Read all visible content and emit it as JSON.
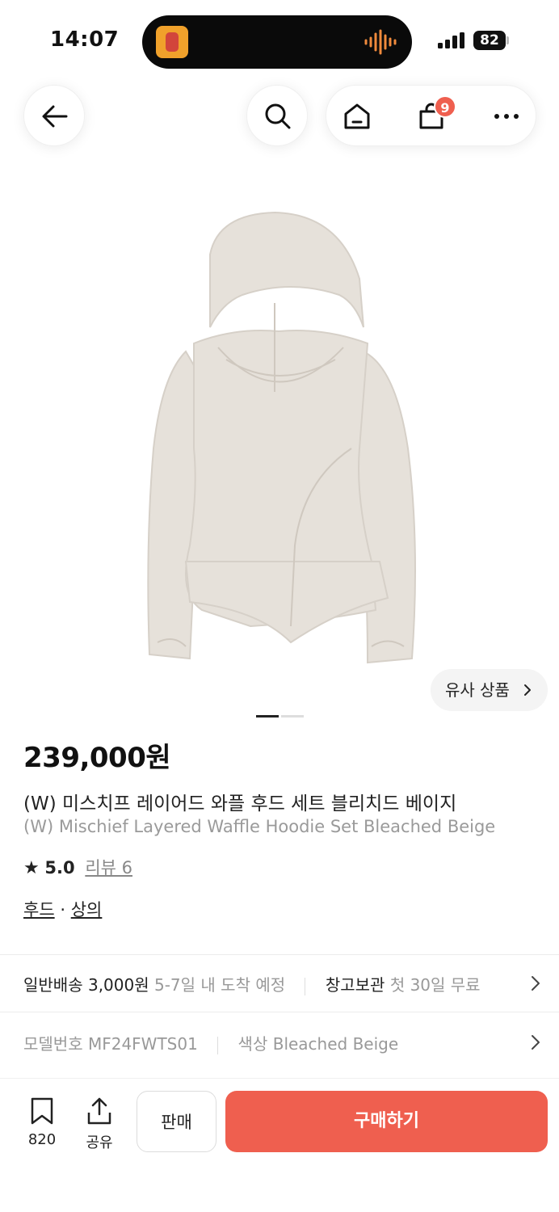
{
  "status_bar": {
    "time": "14:07",
    "battery": "82"
  },
  "nav": {
    "cart_count": "9"
  },
  "product": {
    "price": "239,000원",
    "title_ko": "(W) 미스치프 레이어드 와플 후드 세트 블리치드 베이지",
    "title_en": "(W) Mischief Layered Waffle Hoodie Set Bleached Beige",
    "rating": "5.0",
    "review_label": "리뷰 6",
    "category_1": "후드",
    "category_sep": "·",
    "category_2": "상의",
    "similar_label": "유사 상품",
    "image_page": {
      "current": 1,
      "total": 2
    }
  },
  "shipping": {
    "label": "일반배송",
    "fee": "3,000원",
    "eta": "5-7일 내 도착 예정",
    "warehouse_label": "창고보관",
    "warehouse_note": "첫 30일 무료"
  },
  "details": {
    "model_label": "모델번호",
    "model_value": "MF24FWTS01",
    "color_label": "색상",
    "color_value": "Bleached Beige"
  },
  "bottom_bar": {
    "bookmark_count": "820",
    "share_label": "공유",
    "sell_label": "판매",
    "buy_label": "구매하기"
  },
  "colors": {
    "accent": "#ef5f4f",
    "garment": "#e6e1da"
  }
}
